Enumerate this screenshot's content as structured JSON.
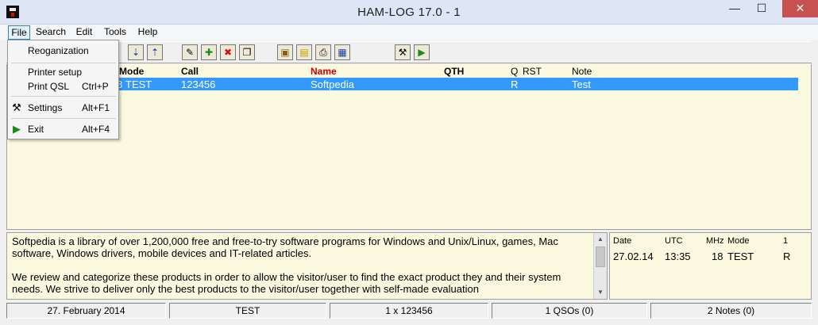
{
  "window": {
    "title": "HAM-LOG  17.0 -  1",
    "minimize": "—",
    "maximize": "☐",
    "close": "✕"
  },
  "menu": [
    "File",
    "Search",
    "Edit",
    "Tools",
    "Help"
  ],
  "file_menu": [
    {
      "label": "Reoganization",
      "shortcut": "",
      "icon": ""
    },
    {
      "label": "Printer setup",
      "shortcut": "",
      "icon": ""
    },
    {
      "label": "Print QSL",
      "shortcut": "Ctrl+P",
      "icon": ""
    },
    {
      "label": "Settings",
      "shortcut": "Alt+F1",
      "icon": "tools-icon"
    },
    {
      "label": "Exit",
      "shortcut": "Alt+F4",
      "icon": "exit-door-icon"
    }
  ],
  "toolbar_icons": [
    "sort-down-icon",
    "sort-up-icon",
    "edit-pencil-icon",
    "new-entry-icon",
    "delete-icon",
    "copy-icon",
    "import-icon",
    "notes-icon",
    "printer-icon",
    "window-icon",
    "tools-icon",
    "exit-door-icon"
  ],
  "log_table": {
    "headers": {
      "mode": "Mode",
      "call": "Call",
      "name": "Name",
      "qth": "QTH",
      "q": "Q",
      "rst": "RST",
      "note": "Note"
    },
    "row": {
      "mode_partial": "8",
      "mode": "TEST",
      "call": "123456",
      "name": "Softpedia",
      "qth": "",
      "q": "R",
      "rst": "",
      "note": "Test"
    },
    "name_header_color": "#d00000",
    "selection_color": "#3399ff"
  },
  "notes_text": [
    "Softpedia is a library of over 1,200,000 free and free-to-try software programs for Windows and Unix/Linux, games, Mac software, Windows drivers, mobile devices and IT-related articles.",
    "We review and categorize these products in order to allow the visitor/user to find the exact product they and their system needs. We strive to deliver only the best products to the visitor/user together with self-made evaluation"
  ],
  "qso_panel": {
    "headers": {
      "date": "Date",
      "utc": "UTC",
      "mhz": "MHz",
      "mode": "Mode",
      "num": "1"
    },
    "row": {
      "date": "27.02.14",
      "utc": "13:35",
      "mhz": "18",
      "mode": "TEST",
      "num": "R"
    }
  },
  "status": [
    "27. February 2014",
    "TEST",
    "1 x 123456",
    "1 QSOs (0)",
    "2 Notes (0)"
  ],
  "colors": {
    "log_background": "#fbf8e0",
    "titlebar": "#dce6f4",
    "close_button": "#c75050"
  }
}
